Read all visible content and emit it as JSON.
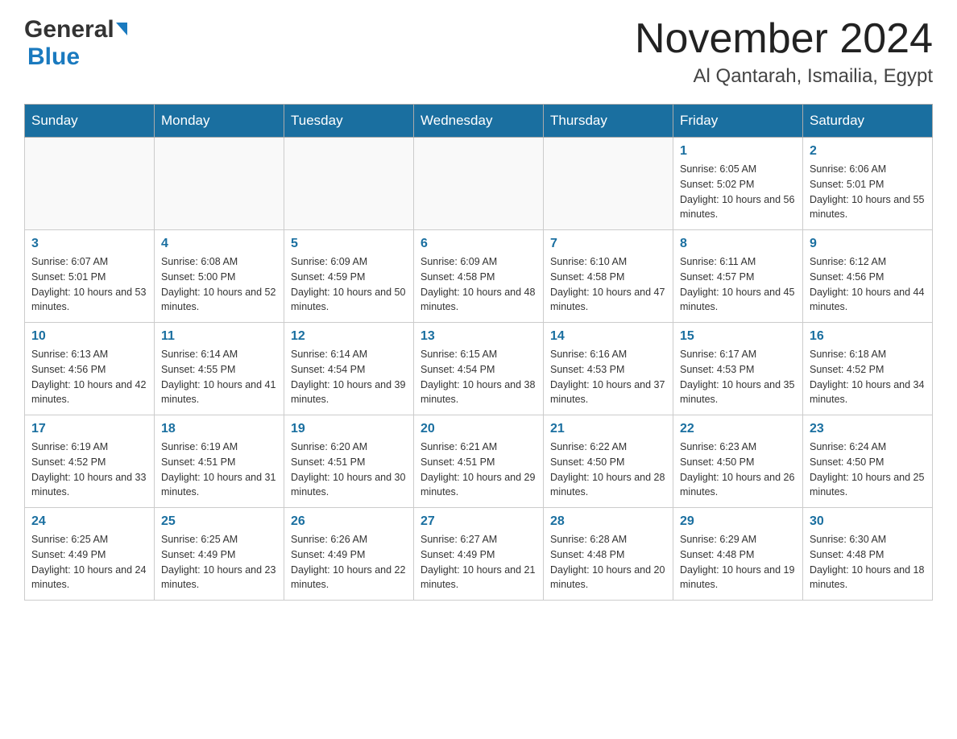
{
  "header": {
    "logo_general": "General",
    "logo_blue": "Blue",
    "month": "November 2024",
    "location": "Al Qantarah, Ismailia, Egypt"
  },
  "weekdays": [
    "Sunday",
    "Monday",
    "Tuesday",
    "Wednesday",
    "Thursday",
    "Friday",
    "Saturday"
  ],
  "weeks": [
    [
      {
        "day": "",
        "info": ""
      },
      {
        "day": "",
        "info": ""
      },
      {
        "day": "",
        "info": ""
      },
      {
        "day": "",
        "info": ""
      },
      {
        "day": "",
        "info": ""
      },
      {
        "day": "1",
        "info": "Sunrise: 6:05 AM\nSunset: 5:02 PM\nDaylight: 10 hours and 56 minutes."
      },
      {
        "day": "2",
        "info": "Sunrise: 6:06 AM\nSunset: 5:01 PM\nDaylight: 10 hours and 55 minutes."
      }
    ],
    [
      {
        "day": "3",
        "info": "Sunrise: 6:07 AM\nSunset: 5:01 PM\nDaylight: 10 hours and 53 minutes."
      },
      {
        "day": "4",
        "info": "Sunrise: 6:08 AM\nSunset: 5:00 PM\nDaylight: 10 hours and 52 minutes."
      },
      {
        "day": "5",
        "info": "Sunrise: 6:09 AM\nSunset: 4:59 PM\nDaylight: 10 hours and 50 minutes."
      },
      {
        "day": "6",
        "info": "Sunrise: 6:09 AM\nSunset: 4:58 PM\nDaylight: 10 hours and 48 minutes."
      },
      {
        "day": "7",
        "info": "Sunrise: 6:10 AM\nSunset: 4:58 PM\nDaylight: 10 hours and 47 minutes."
      },
      {
        "day": "8",
        "info": "Sunrise: 6:11 AM\nSunset: 4:57 PM\nDaylight: 10 hours and 45 minutes."
      },
      {
        "day": "9",
        "info": "Sunrise: 6:12 AM\nSunset: 4:56 PM\nDaylight: 10 hours and 44 minutes."
      }
    ],
    [
      {
        "day": "10",
        "info": "Sunrise: 6:13 AM\nSunset: 4:56 PM\nDaylight: 10 hours and 42 minutes."
      },
      {
        "day": "11",
        "info": "Sunrise: 6:14 AM\nSunset: 4:55 PM\nDaylight: 10 hours and 41 minutes."
      },
      {
        "day": "12",
        "info": "Sunrise: 6:14 AM\nSunset: 4:54 PM\nDaylight: 10 hours and 39 minutes."
      },
      {
        "day": "13",
        "info": "Sunrise: 6:15 AM\nSunset: 4:54 PM\nDaylight: 10 hours and 38 minutes."
      },
      {
        "day": "14",
        "info": "Sunrise: 6:16 AM\nSunset: 4:53 PM\nDaylight: 10 hours and 37 minutes."
      },
      {
        "day": "15",
        "info": "Sunrise: 6:17 AM\nSunset: 4:53 PM\nDaylight: 10 hours and 35 minutes."
      },
      {
        "day": "16",
        "info": "Sunrise: 6:18 AM\nSunset: 4:52 PM\nDaylight: 10 hours and 34 minutes."
      }
    ],
    [
      {
        "day": "17",
        "info": "Sunrise: 6:19 AM\nSunset: 4:52 PM\nDaylight: 10 hours and 33 minutes."
      },
      {
        "day": "18",
        "info": "Sunrise: 6:19 AM\nSunset: 4:51 PM\nDaylight: 10 hours and 31 minutes."
      },
      {
        "day": "19",
        "info": "Sunrise: 6:20 AM\nSunset: 4:51 PM\nDaylight: 10 hours and 30 minutes."
      },
      {
        "day": "20",
        "info": "Sunrise: 6:21 AM\nSunset: 4:51 PM\nDaylight: 10 hours and 29 minutes."
      },
      {
        "day": "21",
        "info": "Sunrise: 6:22 AM\nSunset: 4:50 PM\nDaylight: 10 hours and 28 minutes."
      },
      {
        "day": "22",
        "info": "Sunrise: 6:23 AM\nSunset: 4:50 PM\nDaylight: 10 hours and 26 minutes."
      },
      {
        "day": "23",
        "info": "Sunrise: 6:24 AM\nSunset: 4:50 PM\nDaylight: 10 hours and 25 minutes."
      }
    ],
    [
      {
        "day": "24",
        "info": "Sunrise: 6:25 AM\nSunset: 4:49 PM\nDaylight: 10 hours and 24 minutes."
      },
      {
        "day": "25",
        "info": "Sunrise: 6:25 AM\nSunset: 4:49 PM\nDaylight: 10 hours and 23 minutes."
      },
      {
        "day": "26",
        "info": "Sunrise: 6:26 AM\nSunset: 4:49 PM\nDaylight: 10 hours and 22 minutes."
      },
      {
        "day": "27",
        "info": "Sunrise: 6:27 AM\nSunset: 4:49 PM\nDaylight: 10 hours and 21 minutes."
      },
      {
        "day": "28",
        "info": "Sunrise: 6:28 AM\nSunset: 4:48 PM\nDaylight: 10 hours and 20 minutes."
      },
      {
        "day": "29",
        "info": "Sunrise: 6:29 AM\nSunset: 4:48 PM\nDaylight: 10 hours and 19 minutes."
      },
      {
        "day": "30",
        "info": "Sunrise: 6:30 AM\nSunset: 4:48 PM\nDaylight: 10 hours and 18 minutes."
      }
    ]
  ]
}
